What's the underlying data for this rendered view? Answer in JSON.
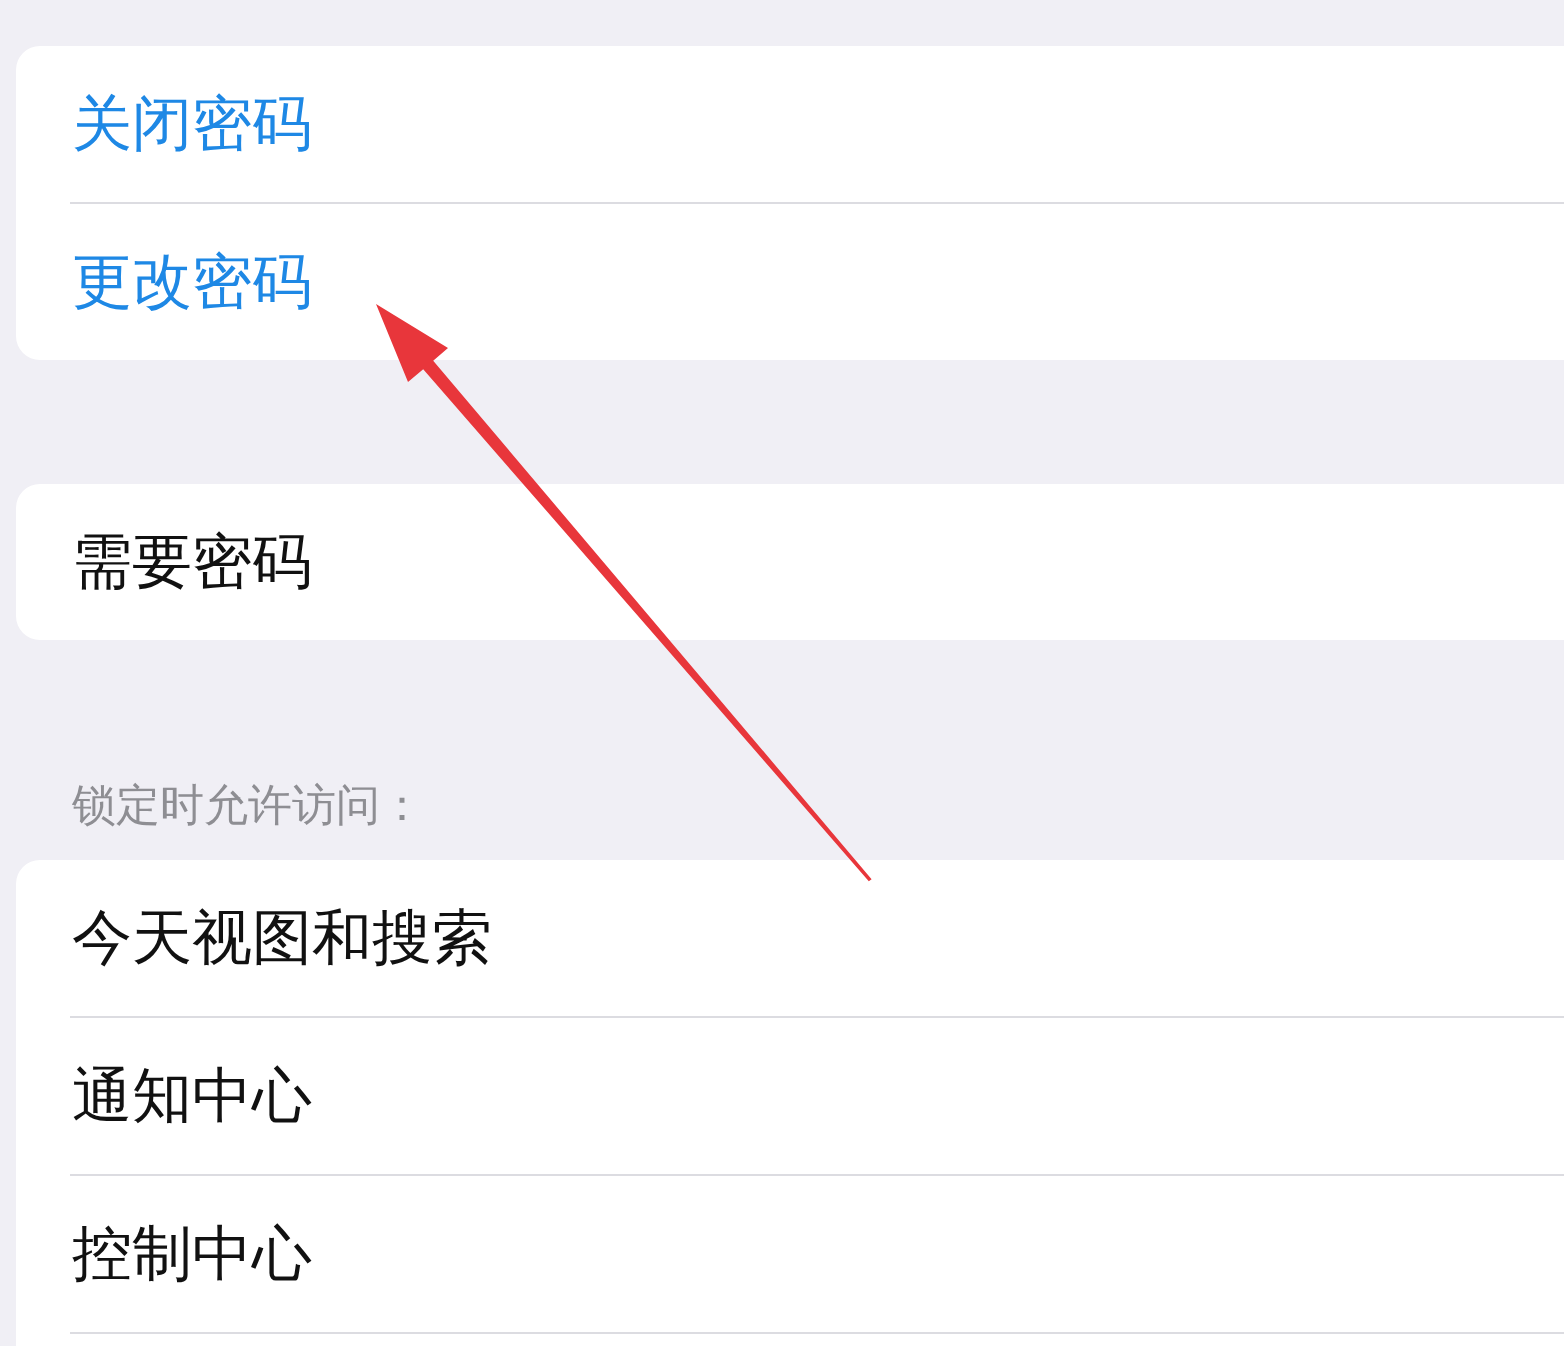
{
  "groups": [
    {
      "items": [
        {
          "label": "关闭密码",
          "kind": "action"
        },
        {
          "label": "更改密码",
          "kind": "action"
        }
      ]
    },
    {
      "items": [
        {
          "label": "需要密码",
          "kind": "plain"
        }
      ]
    },
    {
      "header": "锁定时允许访问：",
      "items": [
        {
          "label": "今天视图和搜索",
          "kind": "plain"
        },
        {
          "label": "通知中心",
          "kind": "plain"
        },
        {
          "label": "控制中心",
          "kind": "plain"
        }
      ]
    }
  ]
}
